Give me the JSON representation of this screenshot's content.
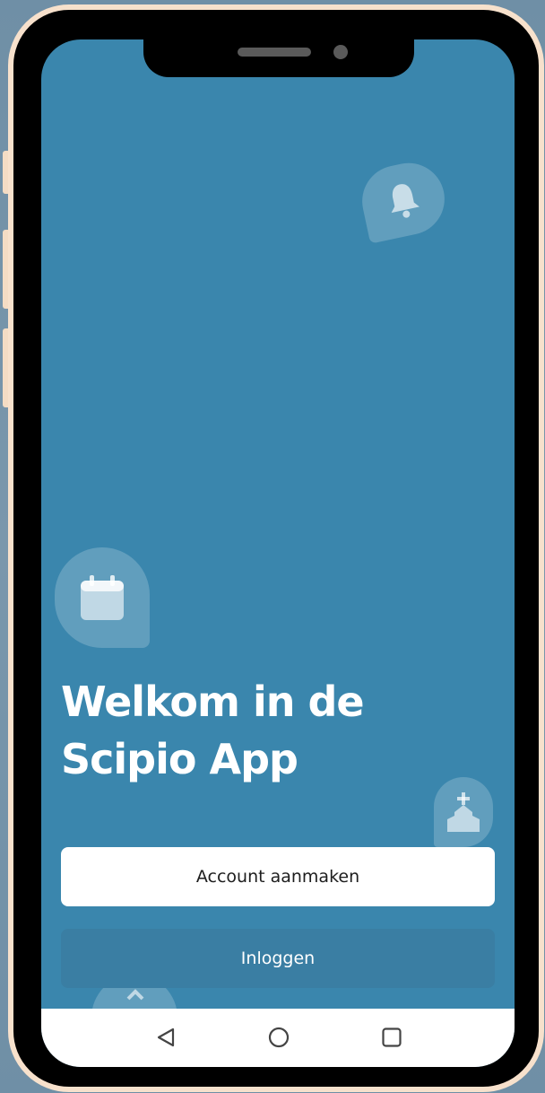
{
  "welcome": {
    "line1": "Welkom in de",
    "line2": "Scipio App"
  },
  "buttons": {
    "create_account": "Account aanmaken",
    "login": "Inloggen"
  },
  "icons": {
    "bell": "bell-icon",
    "calendar": "calendar-icon",
    "church": "church-icon",
    "partial": "partial-icon"
  },
  "navigation": {
    "back": "triangle-back-icon",
    "home": "circle-home-icon",
    "recents": "square-recents-icon"
  },
  "colors": {
    "screen_background": "#3a86ad",
    "primary_button": "#ffffff",
    "secondary_button": "#3a7ea3",
    "frame": "#000000",
    "frame_border": "#f7e1cc"
  }
}
